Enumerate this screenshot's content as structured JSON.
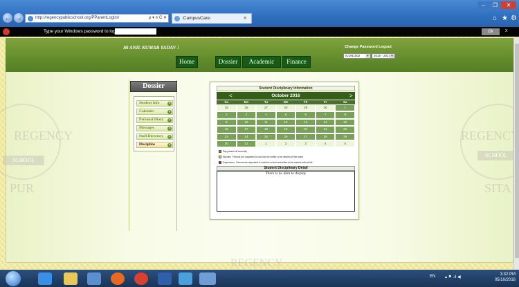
{
  "browser": {
    "url": "http://regencypublicschool.org/PParentLogin/r",
    "url_tools": "ρ ▾ ≡ C ✕",
    "tab_label": ":CampusCare:",
    "tab_close": "✕",
    "back_icon": "back-arrow-icon",
    "forward_icon": "forward-arrow-icon",
    "home_icon": "⌂",
    "star_icon": "★",
    "gear_icon": "⚙",
    "min_label": "–",
    "max_label": "❐",
    "close_label": "✕"
  },
  "password_bar": {
    "label": "Type your Windows password to log on:",
    "ok_label": "Ok",
    "close_label": "x"
  },
  "header": {
    "greeting": "Hi ANIL KUMAR YADAV !",
    "change_password": "Change Password",
    "logout": "Logout",
    "school_select": "ICON1002",
    "session_select": "2016 - 2017",
    "select_arrow": "▾",
    "nav": [
      "Home",
      "Dossier",
      "Academic",
      "Finance"
    ]
  },
  "sidebar": {
    "title": "Dossier",
    "chevron": "»",
    "items": [
      {
        "label": "Student Info",
        "active": false
      },
      {
        "label": "Calender",
        "active": false
      },
      {
        "label": "Personal Diary",
        "active": false
      },
      {
        "label": "Messages",
        "active": false
      },
      {
        "label": "Staff Directory",
        "active": false
      },
      {
        "label": "Discipline",
        "active": true
      }
    ]
  },
  "main": {
    "heading": "Student Disciplinary Information",
    "calendar": {
      "month": "October 2016",
      "prev": "<",
      "next": ">",
      "weekdays": [
        "Su",
        "Mo",
        "Tu",
        "We",
        "Th",
        "Fr",
        "Sa"
      ],
      "weeks": [
        [
          {
            "d": "25",
            "o": true
          },
          {
            "d": "26",
            "o": true
          },
          {
            "d": "27",
            "o": true
          },
          {
            "d": "28",
            "o": true
          },
          {
            "d": "29",
            "o": true
          },
          {
            "d": "30",
            "o": true
          },
          {
            "d": "1",
            "o": false
          }
        ],
        [
          {
            "d": "2",
            "o": false
          },
          {
            "d": "3",
            "o": false
          },
          {
            "d": "4",
            "o": false
          },
          {
            "d": "5",
            "o": false
          },
          {
            "d": "6",
            "o": false
          },
          {
            "d": "7",
            "o": false
          },
          {
            "d": "8",
            "o": false
          }
        ],
        [
          {
            "d": "9",
            "o": false
          },
          {
            "d": "10",
            "o": false
          },
          {
            "d": "11",
            "o": false
          },
          {
            "d": "12",
            "o": false
          },
          {
            "d": "13",
            "o": false
          },
          {
            "d": "14",
            "o": false
          },
          {
            "d": "15",
            "o": false
          }
        ],
        [
          {
            "d": "16",
            "o": false
          },
          {
            "d": "17",
            "o": false
          },
          {
            "d": "18",
            "o": false
          },
          {
            "d": "19",
            "o": false
          },
          {
            "d": "20",
            "o": false
          },
          {
            "d": "21",
            "o": false
          },
          {
            "d": "22",
            "o": false
          }
        ],
        [
          {
            "d": "23",
            "o": false
          },
          {
            "d": "24",
            "o": false
          },
          {
            "d": "25",
            "o": false
          },
          {
            "d": "26",
            "o": false
          },
          {
            "d": "27",
            "o": false
          },
          {
            "d": "28",
            "o": false
          },
          {
            "d": "29",
            "o": false
          }
        ],
        [
          {
            "d": "30",
            "o": false
          },
          {
            "d": "31",
            "o": false
          },
          {
            "d": "1",
            "o": true
          },
          {
            "d": "2",
            "o": true
          },
          {
            "d": "3",
            "o": true
          },
          {
            "d": "4",
            "o": true
          },
          {
            "d": "5",
            "o": true
          }
        ]
      ]
    },
    "legend": [
      {
        "color": "#6b8e23",
        "text": "Day passed off smoothly"
      },
      {
        "color": "#f0e020",
        "text": "Warnain : Parents are requested to look into the matter in the interest of their ward"
      },
      {
        "color": "#c0182a",
        "text": "Suspension : Parents are requested to meet the school authorities at the earliest without fail"
      }
    ],
    "detail_heading": "Student Disciplinary Detail",
    "no_data": "There is no data to display"
  },
  "watermark": {
    "left_text": "REGENCY",
    "left_banner": "SCHOOL",
    "left_city": "PUR",
    "right_text": "REGENCY",
    "right_banner": "SCHOOL",
    "right_city": "SITA",
    "bottom_text": "REGENCY"
  },
  "taskbar": {
    "lang": "EN",
    "tray": "▴ ⚑ .ıl ◀",
    "time": "3:32 PM",
    "date": "05/10/2016"
  }
}
